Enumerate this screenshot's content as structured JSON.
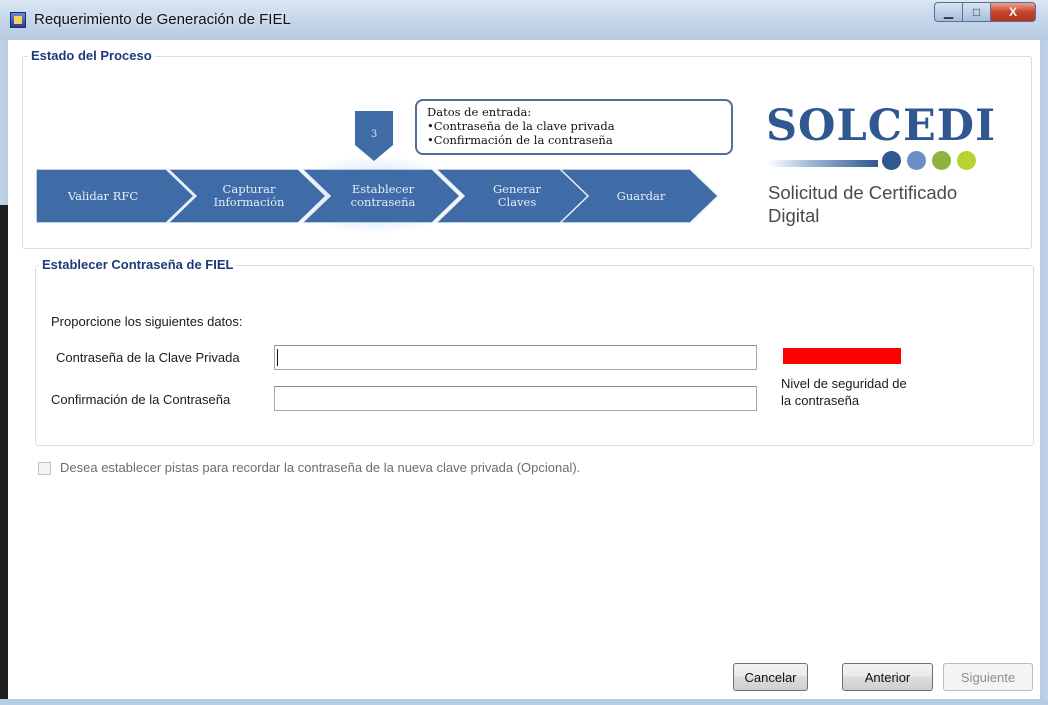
{
  "window": {
    "title": "Requerimiento de Generación de FIEL",
    "minimize_glyph": "▁",
    "maximize_glyph": "□",
    "close_glyph": "X"
  },
  "process": {
    "title": "Estado del Proceso",
    "steps": [
      {
        "label": "Validar  RFC"
      },
      {
        "label": "Capturar\nInformación"
      },
      {
        "label": "Establecer\ncontraseña"
      },
      {
        "label": "Generar\nClaves"
      },
      {
        "label": "Guardar"
      }
    ],
    "current_step_number": "3",
    "callout": {
      "title": "Datos de entrada:",
      "items": [
        "•Contraseña de la clave privada",
        "•Confirmación  de la contraseña"
      ]
    },
    "logo": {
      "name": "SOLCEDI",
      "subtitle_line1": "Solicitud de Certificado",
      "subtitle_line2": "Digital",
      "dot_colors": [
        "#2f5890",
        "#6b8fc4",
        "#8fb33c",
        "#b5d333"
      ]
    }
  },
  "password_section": {
    "title": "Establecer Contraseña de FIEL",
    "instructions": "Proporcione los siguientes datos:",
    "private_key_password_label": "Contraseña de la Clave Privada",
    "private_key_password_value": "",
    "confirm_password_label": "Confirmación de la Contraseña",
    "confirm_password_value": "",
    "strength_label_line1": "Nivel de seguridad de",
    "strength_label_line2": "la contraseña",
    "strength_color": "#ff0000"
  },
  "hints_checkbox": {
    "label": "Desea establecer pistas para recordar la contraseña de la nueva clave privada (Opcional).",
    "checked": false
  },
  "buttons": {
    "cancel": "Cancelar",
    "previous": "Anterior",
    "next": "Siguiente"
  },
  "colors": {
    "accent": "#1f3a7a",
    "step_fill": "#3f6ba6",
    "logo_blue": "#2f5890"
  }
}
